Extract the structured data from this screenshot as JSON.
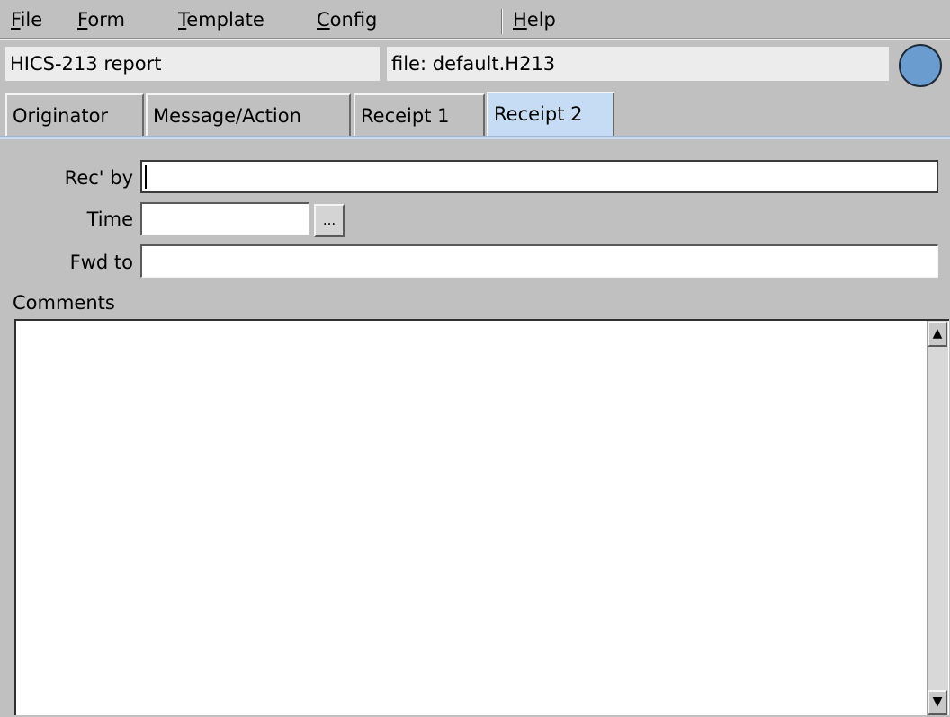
{
  "menubar": {
    "file": {
      "u": "F",
      "rest": "ile"
    },
    "form": {
      "u": "F",
      "rest": "orm"
    },
    "template": {
      "u": "T",
      "rest": "emplate"
    },
    "config": {
      "u": "C",
      "rest": "onfig"
    },
    "help": {
      "u": "H",
      "rest": "elp"
    }
  },
  "info": {
    "form_name": "HICS-213 report",
    "file_label": "file: default.H213",
    "status_color": "#6a9cd0"
  },
  "tabs": {
    "originator": "Originator",
    "message": "Message/Action",
    "receipt1": "Receipt 1",
    "receipt2": "Receipt 2",
    "active": "Receipt 2"
  },
  "form": {
    "rec_by_label": "Rec' by",
    "rec_by_value": "",
    "time_label": "Time",
    "time_value": "",
    "time_button": "...",
    "fwd_to_label": "Fwd to",
    "fwd_to_value": "",
    "comments_label": "Comments",
    "comments_value": ""
  },
  "scroll": {
    "up": "▲",
    "down": "▼"
  }
}
